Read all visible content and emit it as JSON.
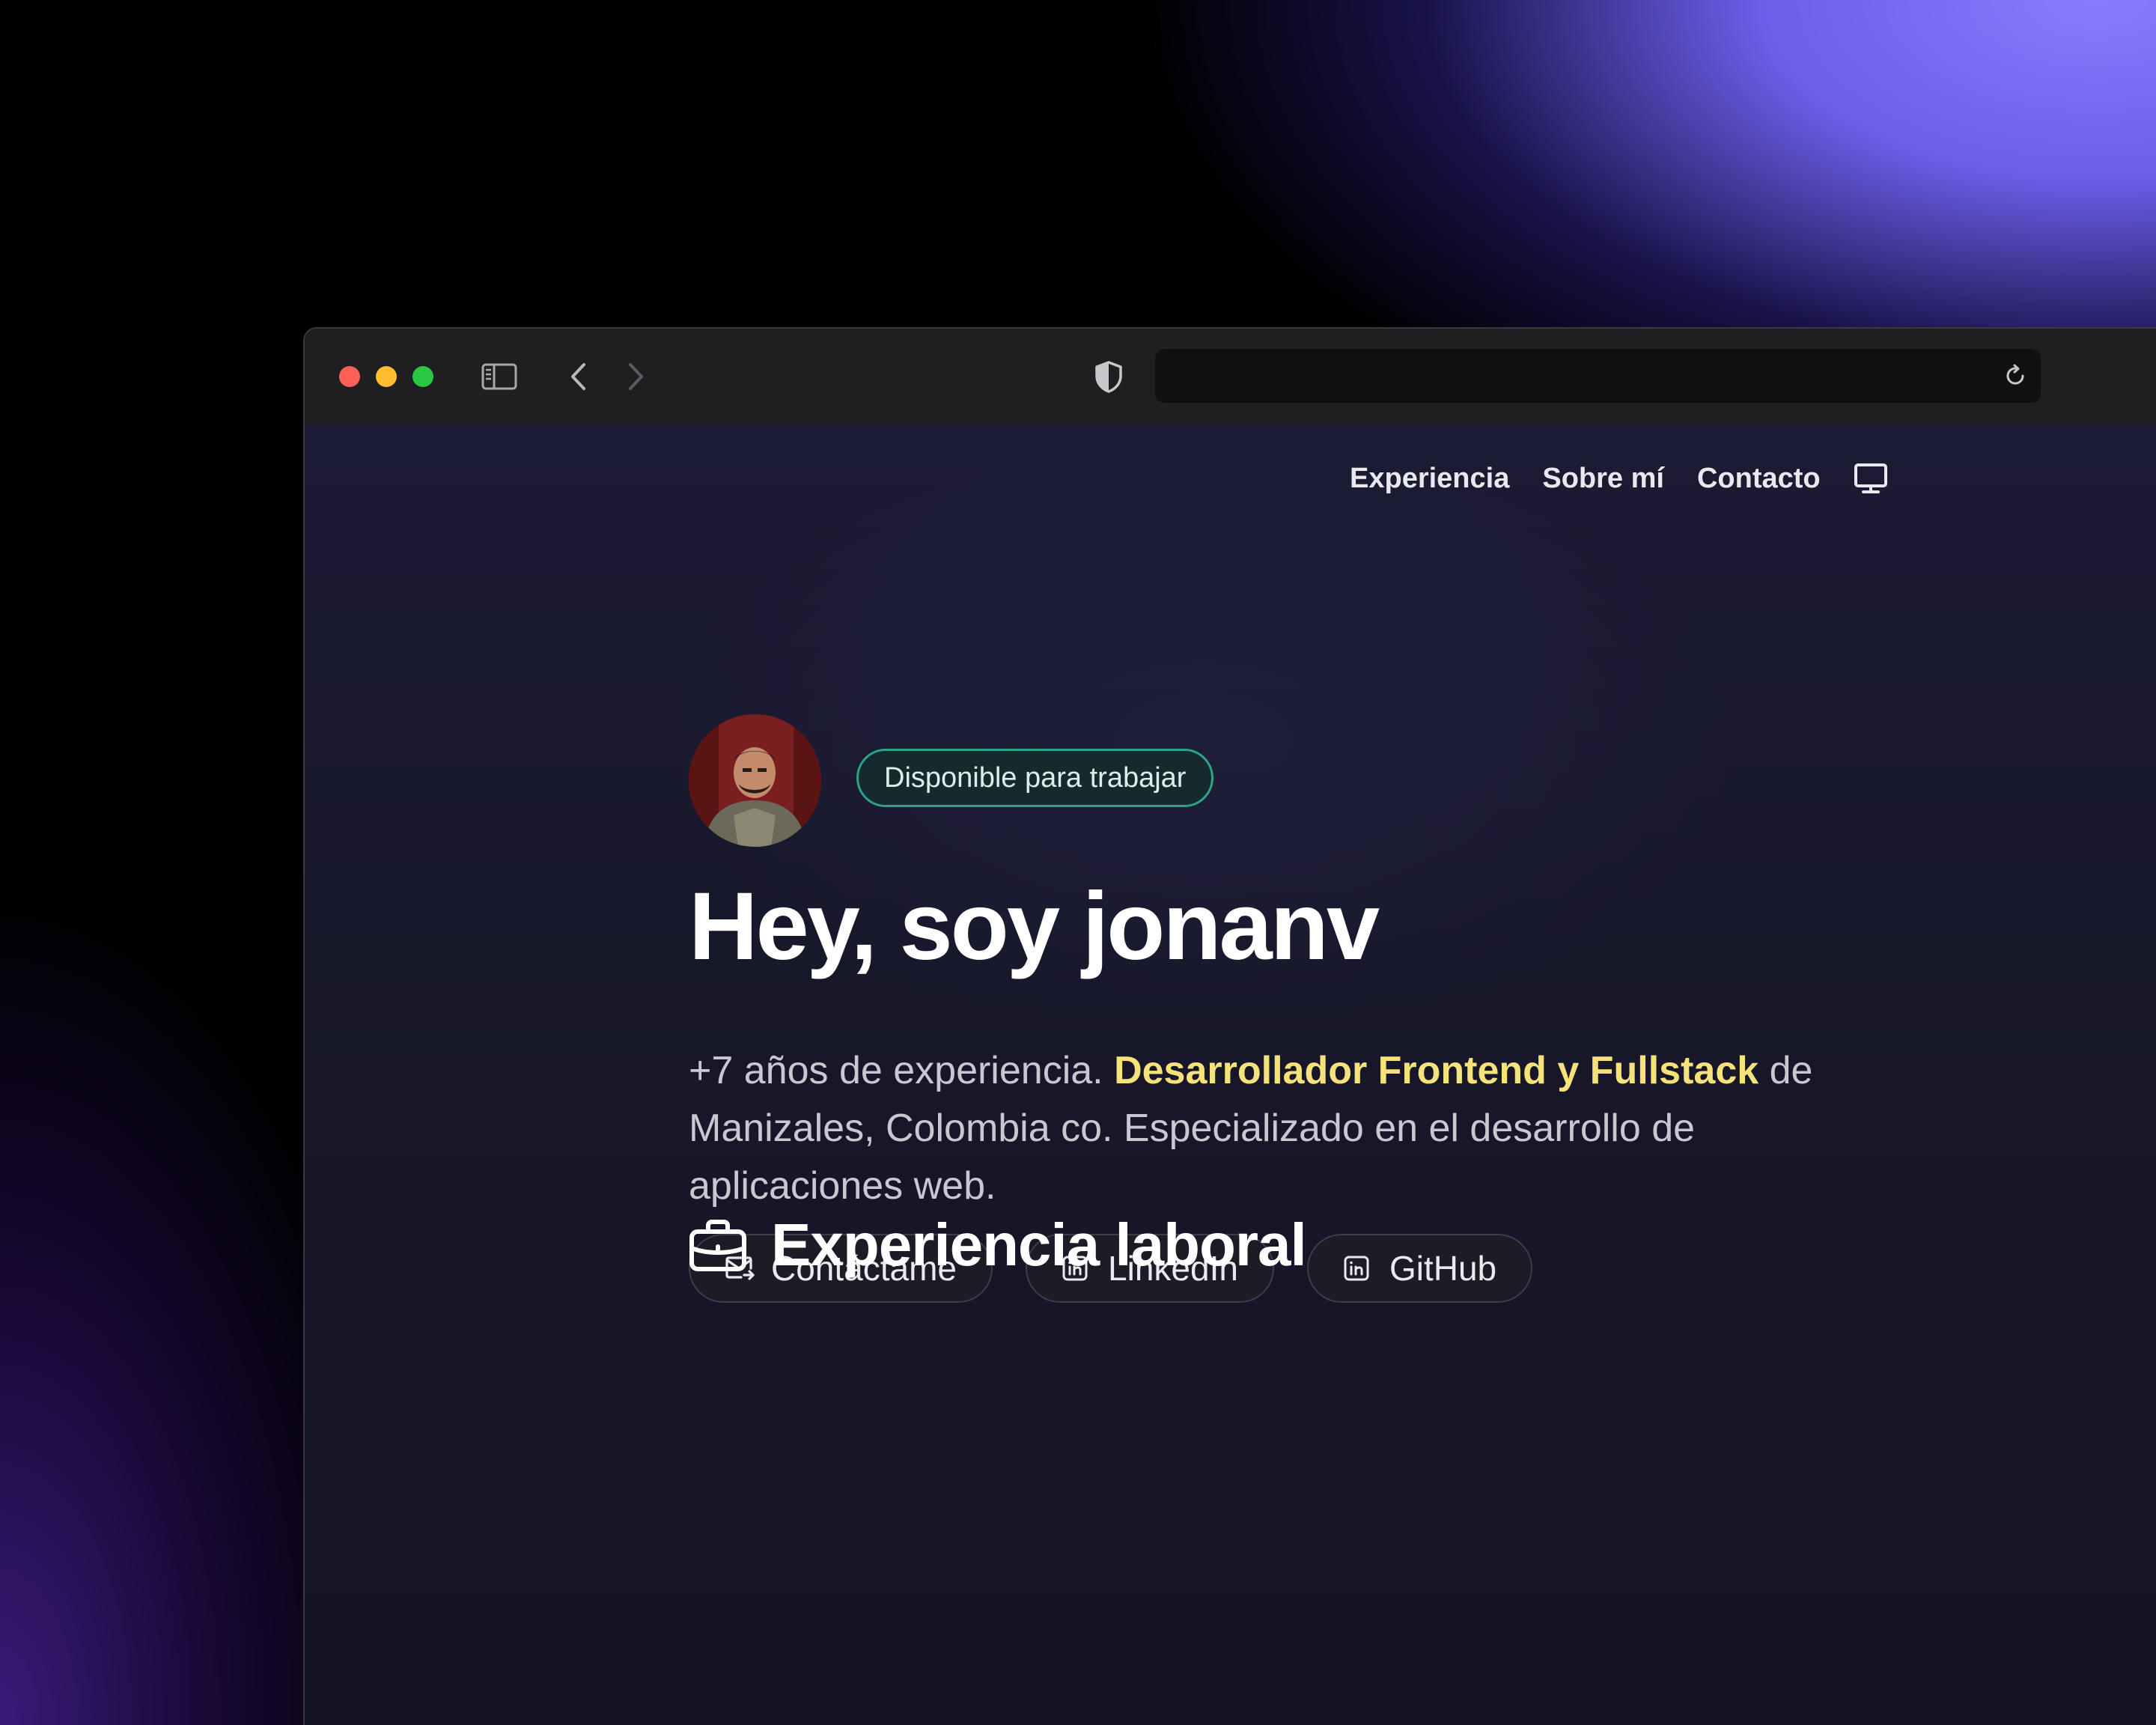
{
  "browser": {
    "url": "",
    "traffic_colors": {
      "close": "#fe5f57",
      "minimize": "#febc2e",
      "zoom": "#28c840"
    }
  },
  "nav": {
    "items": [
      {
        "label": "Experiencia"
      },
      {
        "label": "Sobre mí"
      },
      {
        "label": "Contacto"
      }
    ],
    "theme_icon": "monitor-icon"
  },
  "hero": {
    "badge": "Disponible para trabajar",
    "title": "Hey, soy jonanv",
    "desc_prefix": "+7 años de experiencia. ",
    "desc_highlight": "Desarrollador Frontend y Fullstack",
    "desc_suffix": " de Manizales, Colombia co. Especializado en el desarrollo de aplicaciones web.",
    "buttons": [
      {
        "label": "Contáctame",
        "icon": "mail-icon"
      },
      {
        "label": "LinkedIn",
        "icon": "linkedin-icon"
      },
      {
        "label": "GitHub",
        "icon": "linkedin-icon"
      }
    ]
  },
  "section": {
    "title": "Experiencia laboral",
    "icon": "briefcase-icon"
  },
  "colors": {
    "accent_highlight": "#f5e27a",
    "badge_border": "#2aa58a",
    "page_bg": "#16162a"
  }
}
